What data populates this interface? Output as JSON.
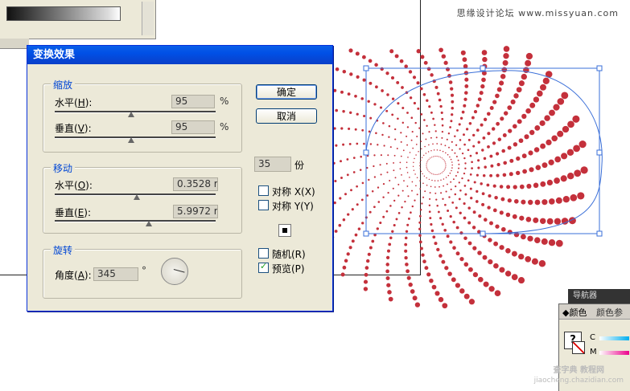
{
  "watermark": {
    "top": "思缘设计论坛 www.missyuan.com",
    "bottom_line1": "查字典 教程网",
    "bottom_line2": "jiaocheng.chazidian.com"
  },
  "dialog": {
    "title": "变换效果",
    "scale": {
      "group_title": "缩放",
      "h_label": "水平(",
      "h_key": "H",
      "h_value": "95",
      "h_unit": "%",
      "h_slider_fraction": 0.95,
      "v_label": "垂直(",
      "v_key": "V",
      "v_value": "95",
      "v_unit": "%",
      "v_slider_fraction": 0.95
    },
    "move": {
      "group_title": "移动",
      "h_label": "水平(",
      "h_key": "O",
      "h_value": "0.3528 r",
      "v_label": "垂直(",
      "v_key": "E",
      "v_value": "5.9972 r"
    },
    "rotate": {
      "group_title": "旋转",
      "angle_label": "角度(",
      "angle_key": "A",
      "angle_value": "345",
      "degree_sign": "°"
    },
    "buttons": {
      "ok": "确定",
      "cancel": "取消"
    },
    "copies": {
      "value": "35",
      "unit": "份"
    },
    "options": {
      "reflect_x_label": "对称 X(X)",
      "reflect_y_label": "对称 Y(Y)",
      "random_label": "随机(R)",
      "preview_label": "预览(P)",
      "reflect_x_checked": false,
      "reflect_y_checked": false,
      "random_checked": false,
      "preview_checked": true
    }
  },
  "color_panel": {
    "tab_color": "颜色",
    "tab_color_ref": "颜色参",
    "navigator_tab": "导航器",
    "row_c": "C",
    "row_m": "M"
  },
  "artwork": {
    "dot_color": "#c4303b",
    "selection_color": "#3a6fd8"
  }
}
